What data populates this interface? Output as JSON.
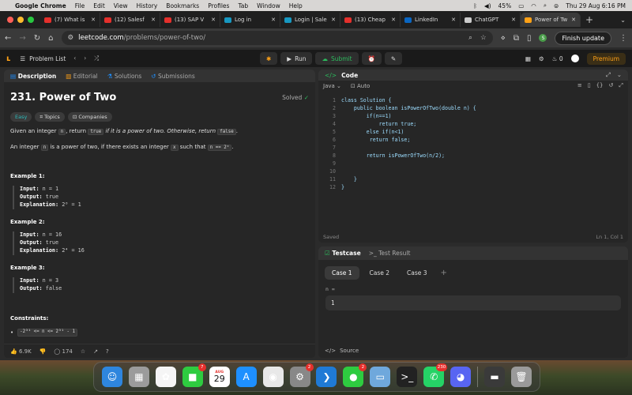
{
  "menubar": {
    "app": "Google Chrome",
    "menus": [
      "File",
      "Edit",
      "View",
      "History",
      "Bookmarks",
      "Profiles",
      "Tab",
      "Window",
      "Help"
    ],
    "battery": "45%",
    "clock": "Thu 29 Aug  6:16 PM"
  },
  "tabs": [
    {
      "title": "(7) What is",
      "fav_color": "#e5302c"
    },
    {
      "title": "(12) Salesf",
      "fav_color": "#e5302c"
    },
    {
      "title": "(13) SAP V",
      "fav_color": "#e5302c"
    },
    {
      "title": "Log in",
      "fav_color": "#1798c1"
    },
    {
      "title": "Login | Sale",
      "fav_color": "#1798c1"
    },
    {
      "title": "(13) Cheap",
      "fav_color": "#e5302c"
    },
    {
      "title": "LinkedIn",
      "fav_color": "#0a66c2"
    },
    {
      "title": "ChatGPT",
      "fav_color": "#cccccc"
    },
    {
      "title": "Power of Tw",
      "fav_color": "#ffa116"
    }
  ],
  "address": {
    "domain": "leetcode.com",
    "path": "/problems/power-of-two/",
    "finish_update": "Finish update",
    "profile_initial": "S"
  },
  "lcnav": {
    "problem_list": "Problem List",
    "run": "Run",
    "submit": "Submit",
    "fire_count": "0",
    "premium": "Premium"
  },
  "left": {
    "tabs": [
      "Description",
      "Editorial",
      "Solutions",
      "Submissions"
    ],
    "title": "231. Power of Two",
    "solved": "Solved",
    "tags": [
      "Easy",
      "Topics",
      "Companies"
    ],
    "para1": {
      "a": "Given an integer ",
      "n": "n",
      "b": ", return ",
      "true": "true",
      "c": " if it is a power of two. Otherwise, return ",
      "false": "false",
      "d": "."
    },
    "para2": {
      "a": "An integer ",
      "n": "n",
      "b": " is a power of two, if there exists an integer ",
      "x": "x",
      "c": " such that ",
      "eq": "n == 2ˣ",
      "d": "."
    },
    "examples": [
      {
        "heading": "Example 1:",
        "input": "n = 1",
        "output": "true",
        "explanation": "2⁰ = 1"
      },
      {
        "heading": "Example 2:",
        "input": "n = 16",
        "output": "true",
        "explanation": "2⁴ = 16"
      },
      {
        "heading": "Example 3:",
        "input": "n = 3",
        "output": "false"
      }
    ],
    "labels": {
      "input": "Input:",
      "output": "Output:",
      "explanation": "Explanation:"
    },
    "constraints_heading": "Constraints:",
    "constraint": "-2³¹ <= n <= 2³¹ - 1",
    "likes": "6.9K",
    "comments": "174"
  },
  "code": {
    "title": "Code",
    "language": "Java",
    "auto": "Auto",
    "lines": [
      "class Solution {",
      "    public boolean isPowerOfTwo(double n) {",
      "        if(n==1)",
      "            return true;",
      "        else if(n<1)",
      "         return false;",
      "",
      "        return isPowerOfTwo(n/2);",
      "",
      "",
      "    }",
      "}"
    ],
    "saved": "Saved",
    "position": "Ln 1, Col 1"
  },
  "testcase": {
    "tab": "Testcase",
    "result_tab": "Test Result",
    "cases": [
      "Case 1",
      "Case 2",
      "Case 3"
    ],
    "label": "n =",
    "value": "1"
  },
  "source": "Source",
  "dock": [
    {
      "name": "finder-icon",
      "glyph": "☺",
      "color": "#2e86de"
    },
    {
      "name": "launchpad-icon",
      "glyph": "▦",
      "color": "#9b9b9b"
    },
    {
      "name": "photos-icon",
      "glyph": "✿",
      "color": "#f5f5f5"
    },
    {
      "name": "facetime-icon",
      "glyph": "■",
      "color": "#2ecc40",
      "badge": "7"
    },
    {
      "name": "calendar-icon",
      "calendar": true,
      "month": "AUG",
      "day": "29"
    },
    {
      "name": "app-store-icon",
      "glyph": "A",
      "color": "#1e90ff"
    },
    {
      "name": "chrome-icon",
      "glyph": "◉",
      "color": "#e8e8e8"
    },
    {
      "name": "system-settings-icon",
      "glyph": "⚙",
      "color": "#888888",
      "badge": "2"
    },
    {
      "name": "vscode-icon",
      "glyph": "❯",
      "color": "#1f7ad6"
    },
    {
      "name": "messages-icon",
      "glyph": "●",
      "color": "#2ecc40",
      "badge": "2"
    },
    {
      "name": "preview-icon",
      "glyph": "▭",
      "color": "#6fa8dc"
    },
    {
      "name": "terminal-icon",
      "glyph": ">_",
      "color": "#222222"
    },
    {
      "name": "whatsapp-icon",
      "glyph": "✆",
      "color": "#25d366",
      "badge": "230"
    },
    {
      "name": "discord-icon",
      "glyph": "◕",
      "color": "#5865f2"
    },
    {
      "name": "screen-window-icon",
      "glyph": "▬",
      "color": "#3a3a3a"
    },
    {
      "name": "trash-icon",
      "glyph": "🗑",
      "color": "#9a9a9a"
    }
  ]
}
